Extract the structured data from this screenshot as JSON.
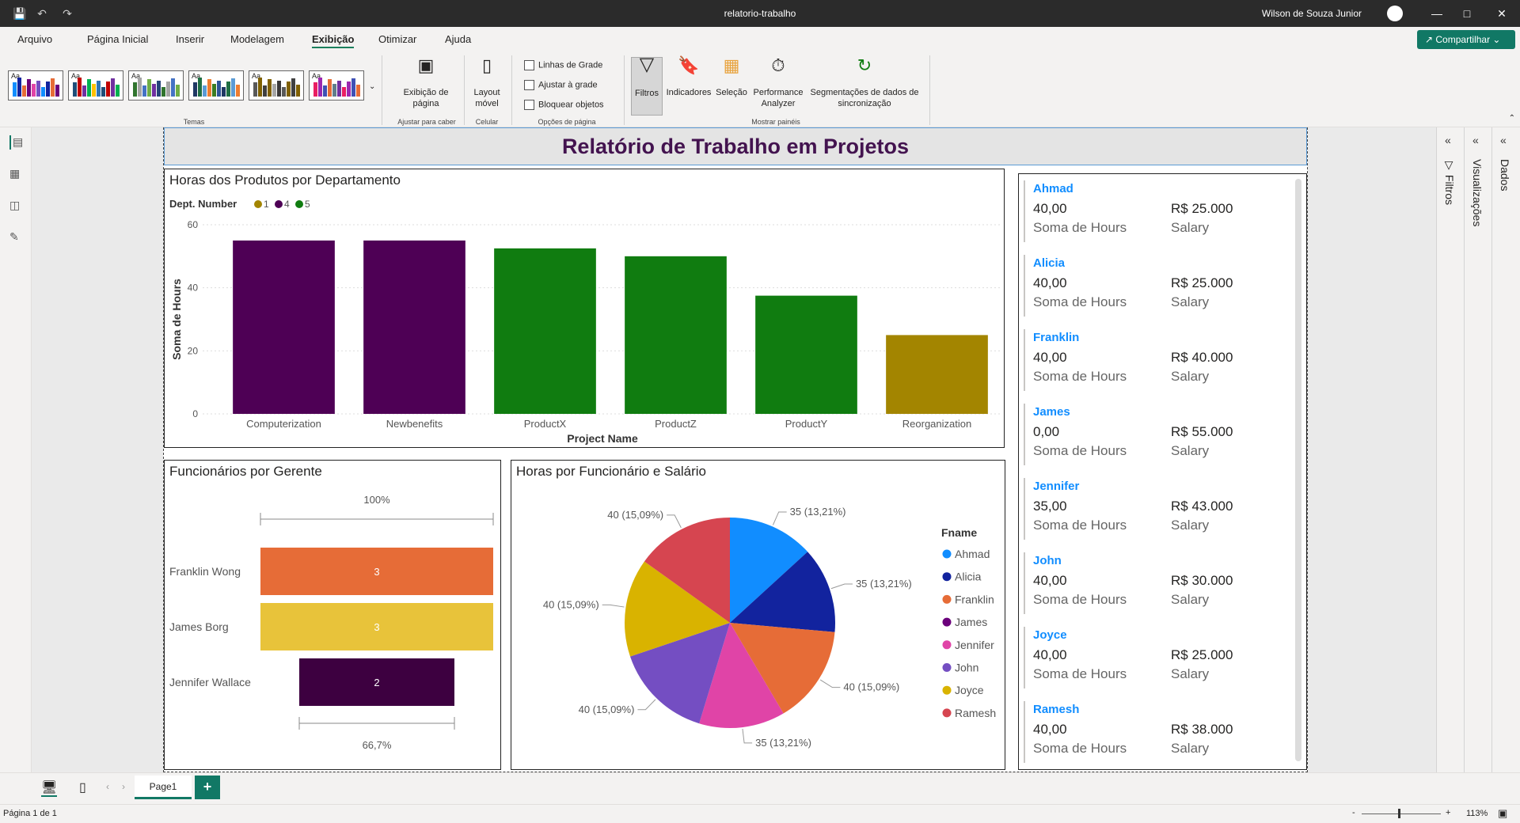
{
  "window": {
    "title": "relatorio-trabalho",
    "user": "Wilson de Souza Junior"
  },
  "menu": {
    "items": [
      "Arquivo",
      "Página Inicial",
      "Inserir",
      "Modelagem",
      "Exibição",
      "Otimizar",
      "Ajuda"
    ],
    "active": "Exibição",
    "share": "Compartilhar"
  },
  "ribbon": {
    "themes_label": "Temas",
    "page_view": "Exibição de página",
    "page_view_group": "Ajustar para caber",
    "mobile": "Layout móvel",
    "mobile_group": "Celular",
    "checks": [
      "Linhas de Grade",
      "Ajustar à grade",
      "Bloquear objetos"
    ],
    "checks_group": "Opções de página",
    "panes": [
      "Filtros",
      "Indicadores",
      "Seleção",
      "Performance Analyzer",
      "Segmentações de dados de sincronização"
    ],
    "panes_group": "Mostrar painéis",
    "theme_tile_text": "Aa"
  },
  "report": {
    "title": "Relatório de Trabalho em Projetos"
  },
  "chart_bar": {
    "title": "Horas dos Produtos por Departamento",
    "legend_title": "Dept. Number",
    "chart_data": {
      "type": "bar",
      "categories": [
        "Computerization",
        "Newbenefits",
        "ProductX",
        "ProductZ",
        "ProductY",
        "Reorganization"
      ],
      "values": [
        55,
        55,
        52.5,
        50,
        37.5,
        25
      ],
      "dept": [
        "4",
        "4",
        "5",
        "5",
        "5",
        "1"
      ],
      "legend": [
        {
          "name": "1",
          "color": "#a38500"
        },
        {
          "name": "4",
          "color": "#4e0055"
        },
        {
          "name": "5",
          "color": "#107c10"
        }
      ],
      "xlabel": "Project Name",
      "ylabel": "Soma de Hours",
      "ylim": [
        0,
        60
      ],
      "yticks": [
        "0",
        "20",
        "40",
        "60"
      ]
    }
  },
  "chart_funnel": {
    "title": "Funcionários por Gerente",
    "top_pct": "100%",
    "bottom_pct": "66,7%",
    "chart_data": {
      "type": "bar",
      "categories": [
        "Franklin Wong",
        "James Borg",
        "Jennifer Wallace"
      ],
      "values": [
        3,
        3,
        2
      ],
      "labels": [
        "3",
        "3",
        "2"
      ],
      "colors": [
        "#e66c37",
        "#e8c33a",
        "#3d0040"
      ]
    }
  },
  "chart_pie": {
    "title": "Horas por Funcionário e Salário",
    "legend_title": "Fname",
    "chart_data": {
      "type": "pie",
      "categories": [
        "Ahmad",
        "Alicia",
        "Franklin",
        "James",
        "Jennifer",
        "John",
        "Joyce",
        "Ramesh"
      ],
      "values": [
        35,
        35,
        40,
        0,
        35,
        40,
        40,
        40
      ],
      "labels": [
        "35 (13,21%)",
        "35 (13,21%)",
        "40 (15,09%)",
        "",
        "35 (13,21%)",
        "40 (15,09%)",
        "40 (15,09%)",
        "40 (15,09%)"
      ],
      "colors": [
        "#118dff",
        "#12239e",
        "#e66c37",
        "#6b007b",
        "#e044a7",
        "#744ec2",
        "#d9b300",
        "#d64550"
      ]
    }
  },
  "cards": [
    {
      "name": "Ahmad",
      "hours": "40,00",
      "salary": "R$ 25.000"
    },
    {
      "name": "Alicia",
      "hours": "40,00",
      "salary": "R$ 25.000"
    },
    {
      "name": "Franklin",
      "hours": "40,00",
      "salary": "R$ 40.000"
    },
    {
      "name": "James",
      "hours": "0,00",
      "salary": "R$ 55.000"
    },
    {
      "name": "Jennifer",
      "hours": "35,00",
      "salary": "R$ 43.000"
    },
    {
      "name": "John",
      "hours": "40,00",
      "salary": "R$ 30.000"
    },
    {
      "name": "Joyce",
      "hours": "40,00",
      "salary": "R$ 25.000"
    },
    {
      "name": "Ramesh",
      "hours": "40,00",
      "salary": "R$ 38.000"
    }
  ],
  "card_labels": {
    "hours": "Soma de Hours",
    "salary": "Salary"
  },
  "panes": {
    "filters": "Filtros",
    "visualizations": "Visualizações",
    "data": "Dados"
  },
  "pages": {
    "tab": "Page1",
    "add": "+"
  },
  "status": {
    "page": "Página 1 de 1",
    "zoom": "113%",
    "minus": "-",
    "plus": "+"
  }
}
